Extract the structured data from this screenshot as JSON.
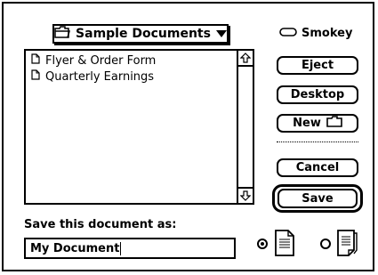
{
  "dialog": {
    "folder_popup_label": "Sample Documents",
    "disk_name": "Smokey",
    "files": [
      {
        "name": "Flyer & Order Form",
        "icon": "document-icon"
      },
      {
        "name": "Quarterly Earnings",
        "icon": "document-icon"
      }
    ],
    "buttons": {
      "eject": "Eject",
      "desktop": "Desktop",
      "new_folder": "New",
      "cancel": "Cancel",
      "save": "Save"
    },
    "save_as_label": "Save this document as:",
    "filename_value": "My Document",
    "format_options": [
      {
        "icon": "text-document-icon",
        "selected": true
      },
      {
        "icon": "stationery-document-icon",
        "selected": false
      }
    ]
  }
}
